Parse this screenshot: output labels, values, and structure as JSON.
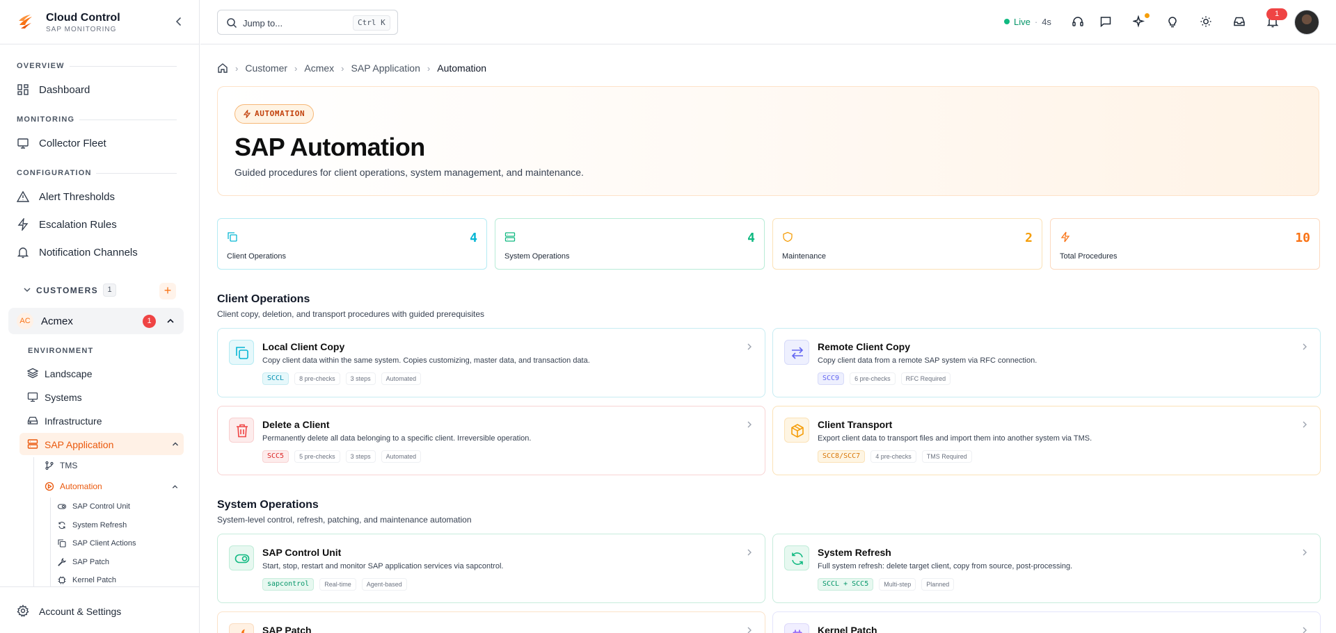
{
  "brand": {
    "title": "Cloud Control",
    "subtitle": "SAP MONITORING"
  },
  "sidebar": {
    "sections": [
      {
        "label": "OVERVIEW",
        "items": [
          {
            "label": "Dashboard"
          }
        ]
      },
      {
        "label": "MONITORING",
        "items": [
          {
            "label": "Collector Fleet"
          }
        ]
      },
      {
        "label": "CONFIGURATION",
        "items": [
          {
            "label": "Alert Thresholds"
          },
          {
            "label": "Escalation Rules"
          },
          {
            "label": "Notification Channels"
          }
        ]
      }
    ],
    "customers_label": "CUSTOMERS",
    "customers_count": "1",
    "add_label": "+",
    "customer": {
      "initials": "AC",
      "name": "Acmex",
      "badge": "1"
    },
    "environment_label": "ENVIRONMENT",
    "env_items": [
      {
        "label": "Landscape"
      },
      {
        "label": "Systems"
      },
      {
        "label": "Infrastructure"
      },
      {
        "label": "SAP Application"
      }
    ],
    "sap_items": [
      {
        "label": "TMS"
      },
      {
        "label": "Automation"
      }
    ],
    "automation_items": [
      {
        "label": "SAP Control Unit"
      },
      {
        "label": "System Refresh"
      },
      {
        "label": "SAP Client Actions"
      },
      {
        "label": "SAP Patch"
      },
      {
        "label": "Kernel Patch"
      }
    ],
    "footer_label": "Account & Settings"
  },
  "topbar": {
    "jump_placeholder": "Jump to...",
    "jump_shortcut": "Ctrl K",
    "live_label": "Live",
    "live_sep": "·",
    "live_time": "4s",
    "notification_count": "1"
  },
  "breadcrumb": [
    "Customer",
    "Acmex",
    "SAP Application",
    "Automation"
  ],
  "hero": {
    "tag": "AUTOMATION",
    "title": "SAP Automation",
    "description": "Guided procedures for client operations, system management, and maintenance."
  },
  "stats": [
    {
      "label": "Client Operations",
      "value": "4",
      "color": "#06b6d4",
      "icon": "copy-icon"
    },
    {
      "label": "System Operations",
      "value": "4",
      "color": "#10b981",
      "icon": "server-icon"
    },
    {
      "label": "Maintenance",
      "value": "2",
      "color": "#f59e0b",
      "icon": "shield-icon"
    },
    {
      "label": "Total Procedures",
      "value": "10",
      "color": "#f97316",
      "icon": "bolt-icon"
    }
  ],
  "groups": [
    {
      "title": "Client Operations",
      "subtitle": "Client copy, deletion, and transport procedures with guided prerequisites",
      "cards": [
        {
          "title": "Local Client Copy",
          "description": "Copy client data within the same system. Copies customizing, master data, and transaction data.",
          "code": "SCCL",
          "tags": [
            "8 pre-checks",
            "3 steps",
            "Automated"
          ]
        },
        {
          "title": "Remote Client Copy",
          "description": "Copy client data from a remote SAP system via RFC connection.",
          "code": "SCC9",
          "tags": [
            "6 pre-checks",
            "RFC Required"
          ]
        },
        {
          "title": "Delete a Client",
          "description": "Permanently delete all data belonging to a specific client. Irreversible operation.",
          "code": "SCC5",
          "tags": [
            "5 pre-checks",
            "3 steps",
            "Automated"
          ]
        },
        {
          "title": "Client Transport",
          "description": "Export client data to transport files and import them into another system via TMS.",
          "code": "SCC8/SCC7",
          "tags": [
            "4 pre-checks",
            "TMS Required"
          ]
        }
      ]
    },
    {
      "title": "System Operations",
      "subtitle": "System-level control, refresh, patching, and maintenance automation",
      "cards": [
        {
          "title": "SAP Control Unit",
          "description": "Start, stop, restart and monitor SAP application services via sapcontrol.",
          "code": "sapcontrol",
          "tags": [
            "Real-time",
            "Agent-based"
          ]
        },
        {
          "title": "System Refresh",
          "description": "Full system refresh: delete target client, copy from source, post-processing.",
          "code": "SCCL + SCC5",
          "tags": [
            "Multi-step",
            "Planned"
          ]
        },
        {
          "title": "SAP Patch",
          "description": "",
          "code": "",
          "tags": []
        },
        {
          "title": "Kernel Patch",
          "description": "",
          "code": "",
          "tags": []
        }
      ]
    }
  ],
  "colors": {
    "accent": "#f97316",
    "cyan": "#06b6d4",
    "green": "#10b981",
    "red": "#ef4444",
    "violet": "#6366f1",
    "amber": "#f59e0b"
  }
}
